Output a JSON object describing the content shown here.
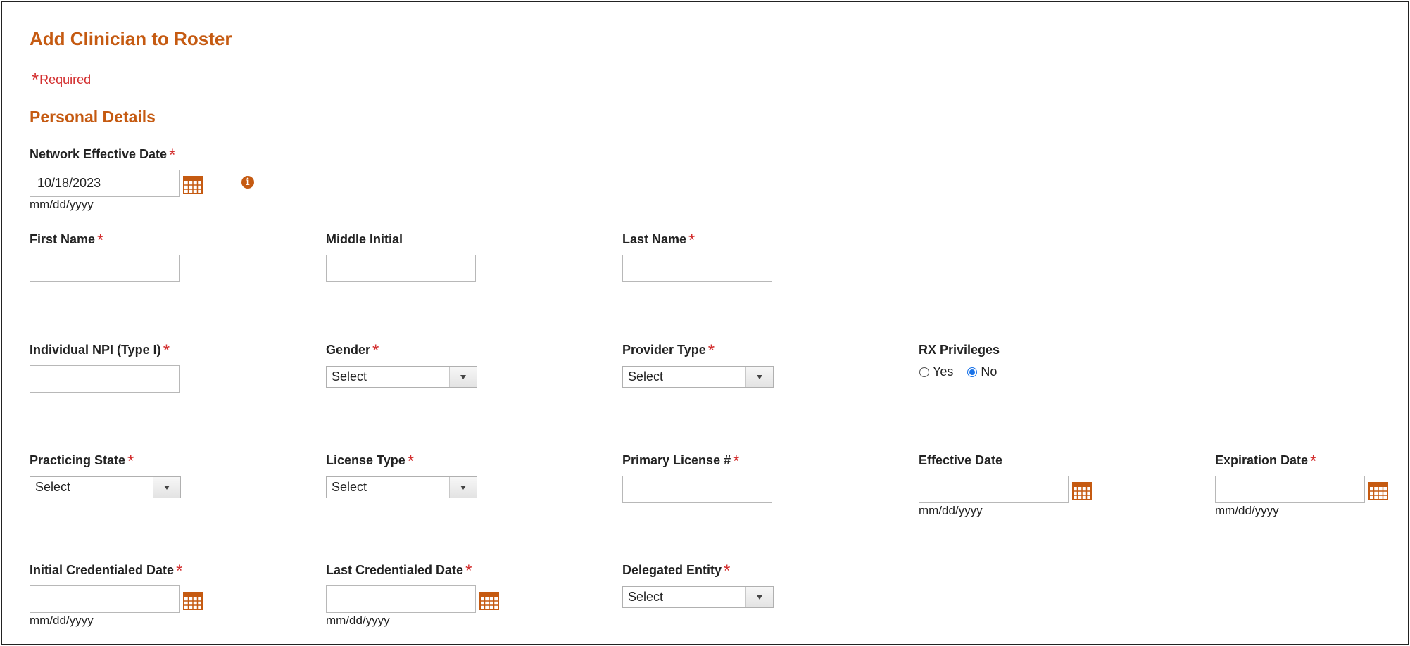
{
  "header": {
    "title": "Add Clinician to Roster",
    "required_star": "*",
    "required_text": "Required",
    "section_title": "Personal Details"
  },
  "date_hint": "mm/dd/yyyy",
  "icons": {
    "calendar": "calendar-icon",
    "info": "info-icon"
  },
  "colors": {
    "accent": "#c55a11",
    "required": "#d32f2f",
    "radio_selected": "#1a73e8"
  },
  "fields": {
    "network_effective_date": {
      "label": "Network Effective Date",
      "required": "*",
      "value": "10/18/2023",
      "info_glyph": "i"
    },
    "first_name": {
      "label": "First Name",
      "required": "*",
      "value": ""
    },
    "middle_initial": {
      "label": "Middle Initial",
      "value": ""
    },
    "last_name": {
      "label": "Last Name",
      "required": "*",
      "value": ""
    },
    "individual_npi": {
      "label": "Individual NPI (Type I)",
      "required": "*",
      "value": ""
    },
    "gender": {
      "label": "Gender",
      "required": "*",
      "selected": "Select"
    },
    "provider_type": {
      "label": "Provider Type",
      "required": "*",
      "selected": "Select"
    },
    "rx_privileges": {
      "label": "RX Privileges",
      "options": [
        "Yes",
        "No"
      ],
      "selected": "No"
    },
    "practicing_state": {
      "label": "Practicing State",
      "required": "*",
      "selected": "Select"
    },
    "license_type": {
      "label": "License Type",
      "required": "*",
      "selected": "Select"
    },
    "primary_license": {
      "label": "Primary License #",
      "required": "*",
      "value": ""
    },
    "effective_date": {
      "label": "Effective Date",
      "value": ""
    },
    "expiration_date": {
      "label": "Expiration Date",
      "required": "*",
      "value": ""
    },
    "initial_credentialed_date": {
      "label": "Initial Credentialed Date",
      "required": "*",
      "value": ""
    },
    "last_credentialed_date": {
      "label": "Last Credentialed Date",
      "required": "*",
      "value": ""
    },
    "delegated_entity": {
      "label": "Delegated Entity",
      "required": "*",
      "selected": "Select"
    }
  }
}
